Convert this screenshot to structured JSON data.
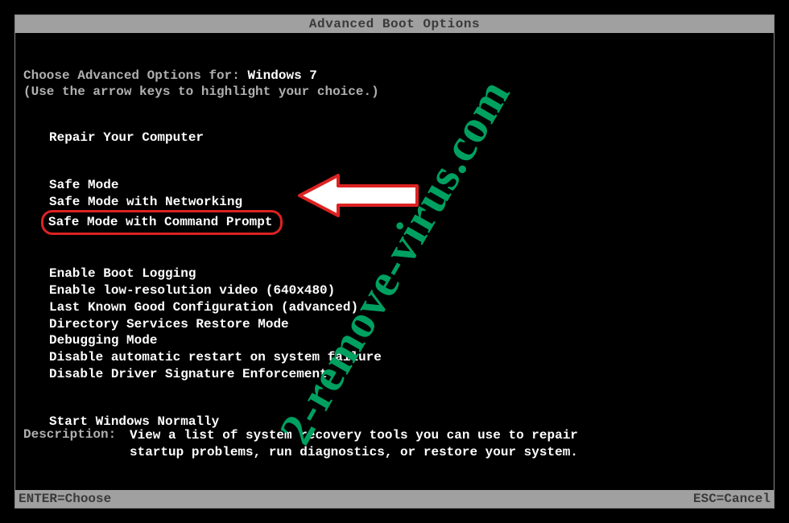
{
  "title": "Advanced Boot Options",
  "choose": {
    "prefix": "Choose Advanced Options for: ",
    "os": "Windows 7",
    "hint": "(Use the arrow keys to highlight your choice.)"
  },
  "groups": [
    {
      "items": [
        "Repair Your Computer"
      ]
    },
    {
      "items": [
        "Safe Mode",
        "Safe Mode with Networking",
        "Safe Mode with Command Prompt"
      ]
    },
    {
      "items": [
        "Enable Boot Logging",
        "Enable low-resolution video (640x480)",
        "Last Known Good Configuration (advanced)",
        "Directory Services Restore Mode",
        "Debugging Mode",
        "Disable automatic restart on system failure",
        "Disable Driver Signature Enforcement"
      ]
    },
    {
      "items": [
        "Start Windows Normally"
      ]
    }
  ],
  "selected_option": "Safe Mode with Command Prompt",
  "description": {
    "label": "Description:",
    "text": "View a list of system recovery tools you can use to repair startup problems, run diagnostics, or restore your system."
  },
  "footer": {
    "left": "ENTER=Choose",
    "right": "ESC=Cancel"
  },
  "watermark": "2-remove-virus.com"
}
